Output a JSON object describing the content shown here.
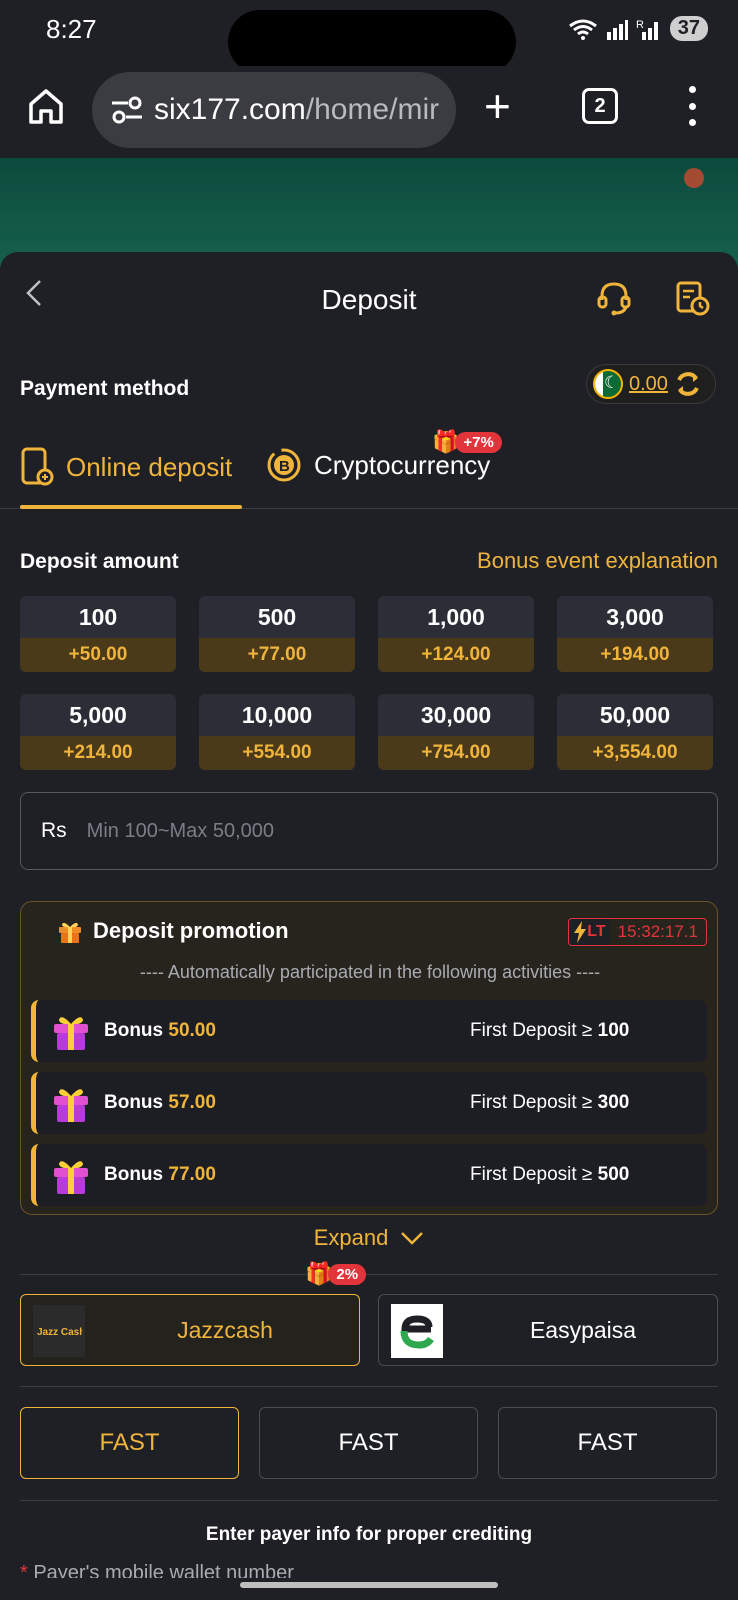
{
  "status": {
    "time": "8:27",
    "battery": "37"
  },
  "browser": {
    "url_domain": "six177.com",
    "url_path": "/home/mir",
    "tab_count": "2"
  },
  "header": {
    "title": "Deposit"
  },
  "payment": {
    "label": "Payment method",
    "balance": "0.00",
    "tabs": [
      {
        "label": "Online deposit"
      },
      {
        "label": "Cryptocurrency",
        "badge": "+7%"
      }
    ]
  },
  "deposit": {
    "label": "Deposit amount",
    "bonus_link": "Bonus event explanation",
    "amounts": [
      {
        "value": "100",
        "bonus": "+50.00"
      },
      {
        "value": "500",
        "bonus": "+77.00"
      },
      {
        "value": "1,000",
        "bonus": "+124.00"
      },
      {
        "value": "3,000",
        "bonus": "+194.00"
      },
      {
        "value": "5,000",
        "bonus": "+214.00"
      },
      {
        "value": "10,000",
        "bonus": "+554.00"
      },
      {
        "value": "30,000",
        "bonus": "+754.00"
      },
      {
        "value": "50,000",
        "bonus": "+3,554.00"
      }
    ],
    "currency": "Rs",
    "placeholder": "Min 100~Max 50,000"
  },
  "promotion": {
    "title": "Deposit promotion",
    "lt_tag": "LT",
    "timer": "15:32:17.1",
    "subtitle": "---- Automatically participated in the following activities ----",
    "rows": [
      {
        "bonus_prefix": "Bonus ",
        "bonus_value": "50.00",
        "cond_prefix": "First Deposit ≥ ",
        "cond_value": "100"
      },
      {
        "bonus_prefix": "Bonus ",
        "bonus_value": "57.00",
        "cond_prefix": "First Deposit ≥ ",
        "cond_value": "300"
      },
      {
        "bonus_prefix": "Bonus ",
        "bonus_value": "77.00",
        "cond_prefix": "First Deposit ≥ ",
        "cond_value": "500"
      }
    ],
    "expand": "Expand"
  },
  "channels": [
    {
      "label": "Jazzcash",
      "logo_text": "Jazz Cash",
      "badge": "2%"
    },
    {
      "label": "Easypaisa"
    }
  ],
  "speeds": [
    "FAST",
    "FAST",
    "FAST"
  ],
  "payer": {
    "info": "Enter payer info for proper crediting",
    "field_label": "Payer's mobile wallet number"
  },
  "colors": {
    "accent": "#f0b43b",
    "background": "#1e2026",
    "badge": "#e2353b"
  }
}
